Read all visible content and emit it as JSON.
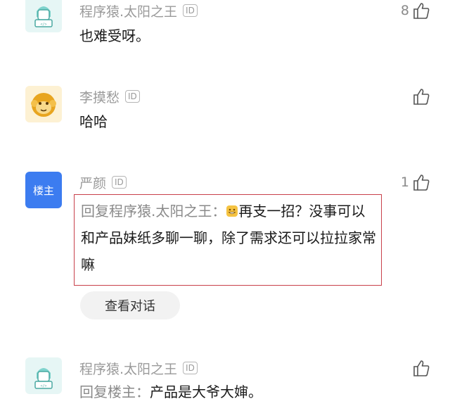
{
  "comments": [
    {
      "user": "程序猿.太阳之王",
      "id_badge": "ID",
      "text": "也难受呀。",
      "likes": "8",
      "avatar": "coder-avatar"
    },
    {
      "user": "李摸愁",
      "id_badge": "ID",
      "text": "哈哈",
      "likes": "",
      "avatar": "monkey-avatar"
    },
    {
      "user": "严颜",
      "id_badge": "ID",
      "avatar_label": "楼主",
      "likes": "1",
      "reply_prefix": "回复程序猿.太阳之王：",
      "reply_text": "再支一招？没事可以和产品妹纸多聊一聊，除了需求还可以拉拉家常嘛",
      "emoji": "grin-emoji",
      "view_conversation": "查看对话"
    },
    {
      "user": "程序猿.太阳之王",
      "id_badge": "ID",
      "reply_prefix": "回复楼主：",
      "text": "产品是大爷大婶。",
      "likes": "",
      "avatar": "coder-avatar"
    }
  ],
  "colors": {
    "highlight_border": "#c8404a",
    "host_badge": "#3c7cf0"
  }
}
